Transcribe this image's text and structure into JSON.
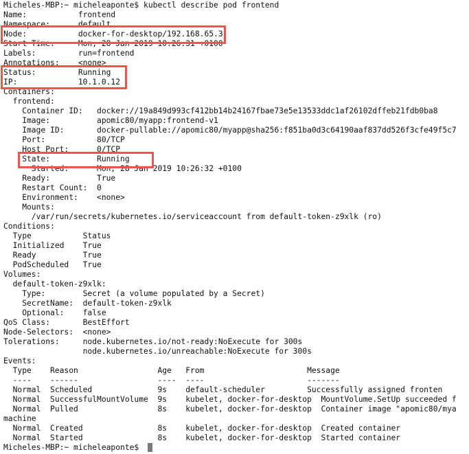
{
  "terminal": {
    "lines": [
      "Micheles-MBP:~ micheleaponte$ kubectl describe pod frontend",
      "Name:           frontend",
      "Namespace:      default",
      "Node:           docker-for-desktop/192.168.65.3",
      "Start Time:     Mon, 28 Jan 2019 10:26:31 +0100",
      "Labels:         run=frontend",
      "Annotations:    <none>",
      "Status:         Running",
      "IP:             10.1.0.12",
      "Containers:",
      "  frontend:",
      "    Container ID:   docker://19a849d993cf412bb14b24167fbae73e5e13533ddc1af26102dffeb21fdb0ba8",
      "    Image:          apomic80/myapp:frontend-v1",
      "    Image ID:       docker-pullable://apomic80/myapp@sha256:f851ba0d3c64190aaf837dd526f3cfe49f5c7",
      "    Port:           80/TCP",
      "    Host Port:      0/TCP",
      "    State:          Running",
      "      Started:      Mon, 28 Jan 2019 10:26:32 +0100",
      "    Ready:          True",
      "    Restart Count:  0",
      "    Environment:    <none>",
      "    Mounts:",
      "      /var/run/secrets/kubernetes.io/serviceaccount from default-token-z9xlk (ro)",
      "Conditions:",
      "  Type           Status",
      "  Initialized    True",
      "  Ready          True",
      "  PodScheduled   True",
      "Volumes:",
      "  default-token-z9xlk:",
      "    Type:        Secret (a volume populated by a Secret)",
      "    SecretName:  default-token-z9xlk",
      "    Optional:    false",
      "QoS Class:       BestEffort",
      "Node-Selectors:  <none>",
      "Tolerations:     node.kubernetes.io/not-ready:NoExecute for 300s",
      "                 node.kubernetes.io/unreachable:NoExecute for 300s",
      "Events:",
      "  Type    Reason                 Age   From                      Message",
      "  ----    ------                 ----  ----                      -------",
      "  Normal  Scheduled              9s    default-scheduler         Successfully assigned fronten",
      "  Normal  SuccessfulMountVolume  9s    kubelet, docker-for-desktop  MountVolume.SetUp succeeded f",
      "  Normal  Pulled                 8s    kubelet, docker-for-desktop  Container image \"apomic80/mya",
      "machine",
      "  Normal  Created                8s    kubelet, docker-for-desktop  Created container",
      "  Normal  Started                8s    kubelet, docker-for-desktop  Started container",
      "Micheles-MBP:~ micheleaponte$ "
    ]
  },
  "colors": {
    "highlight": "#e5584c",
    "text": "#111111",
    "cursor": "#7a7a7a"
  }
}
